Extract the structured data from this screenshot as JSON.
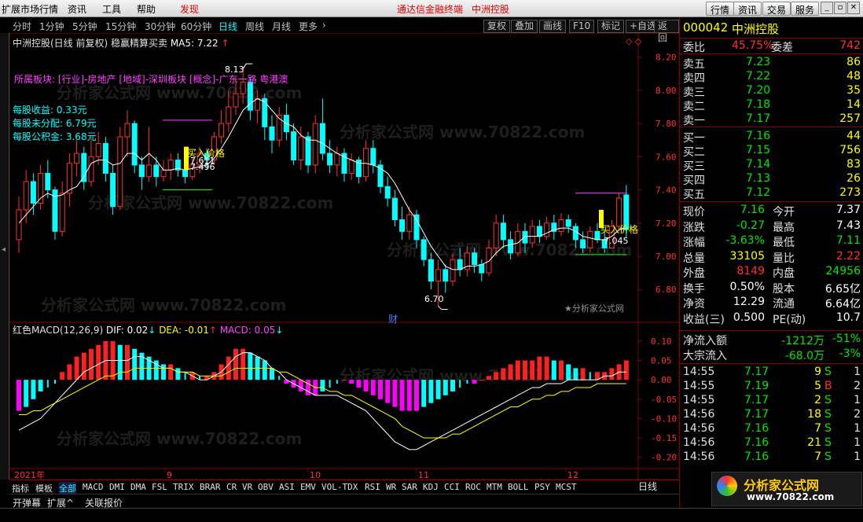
{
  "menu": {
    "items": [
      "扩展市场行情",
      "资讯",
      "工具",
      "帮助"
    ],
    "found": "发现",
    "center1": "通达信金融终端",
    "center2": "中洲控股",
    "right_buttons": [
      "行情",
      "资讯",
      "交易",
      "服务"
    ]
  },
  "periods": {
    "items": [
      "分时",
      "1分钟",
      "5分钟",
      "15分钟",
      "30分钟",
      "60分钟",
      "日线",
      "周线",
      "月线",
      "更多"
    ],
    "active": "日线"
  },
  "tools": [
    "复权",
    "叠加",
    "画线",
    "F10",
    "标记",
    "+自选",
    "返回"
  ],
  "main": {
    "title": "中洲控股(日线 前复权) 稳赢精算买卖",
    "ma": "MA5: 7.22",
    "sector": "所属板块: [行业]-房地产 [地域]-深圳板块 [概念]-广东一路 粤港澳",
    "eps": "每股收益: 0.33元",
    "undist": "每股未分配: 6.79元",
    "fund": "每股公积金: 3.68元",
    "high_label": "8.13",
    "low_label": "6.70",
    "buy_label1": "买入价格",
    "buy_val1a": "7.611",
    "buy_val1b": "7.496",
    "buy_label2": "买入价格",
    "buy_val2": "7.045",
    "cai": "财",
    "brand": "★分析家公式网"
  },
  "macd": {
    "title": "红色MACD(12,26,9)",
    "dif": "DIF: 0.02",
    "dea": "DEA: -0.01",
    "macd": "MACD: 0.05"
  },
  "axis": {
    "price_ticks": [
      "8.20",
      "8.00",
      "7.80",
      "7.60",
      "7.40",
      "7.20",
      "7.00",
      "6.80"
    ],
    "macd_ticks": [
      "0.10",
      "0.05",
      "0.00",
      "-0.05",
      "-0.10",
      "-0.15",
      "-0.20"
    ],
    "x_ticks": [
      "2021年",
      "9",
      "10",
      "11",
      "12"
    ]
  },
  "indicators": {
    "items": [
      "指标",
      "模板",
      "全部",
      "MACD",
      "DMI",
      "DMA",
      "FSL",
      "TRIX",
      "BRAR",
      "CR",
      "VR",
      "OBV",
      "ASI",
      "EMV",
      "VOL-TDX",
      "RSI",
      "WR",
      "SAR",
      "KDJ",
      "CCI",
      "ROC",
      "MTM",
      "BOLL",
      "PSY",
      "MCST"
    ],
    "active": "全部",
    "period": "日线"
  },
  "bottom2": {
    "items": [
      "开弹幕",
      "扩展^",
      "关联报价"
    ]
  },
  "stock": {
    "code": "000042",
    "name": "中洲控股"
  },
  "weibi": {
    "label1": "委比",
    "val1": "45.75%",
    "label2": "委差",
    "val2": "742"
  },
  "sell": [
    {
      "l": "卖五",
      "p": "7.23",
      "v": "86"
    },
    {
      "l": "卖四",
      "p": "7.22",
      "v": "48"
    },
    {
      "l": "卖三",
      "p": "7.20",
      "v": "35"
    },
    {
      "l": "卖二",
      "p": "7.18",
      "v": "14"
    },
    {
      "l": "卖一",
      "p": "7.17",
      "v": "257"
    }
  ],
  "buy": [
    {
      "l": "买一",
      "p": "7.16",
      "v": "44"
    },
    {
      "l": "买二",
      "p": "7.15",
      "v": "756"
    },
    {
      "l": "买三",
      "p": "7.14",
      "v": "83"
    },
    {
      "l": "买四",
      "p": "7.13",
      "v": "26"
    },
    {
      "l": "买五",
      "p": "7.12",
      "v": "273"
    }
  ],
  "quote": [
    {
      "l1": "现价",
      "v1": "7.16",
      "l2": "今开",
      "v2": "7.37"
    },
    {
      "l1": "涨跌",
      "v1": "-0.27",
      "l2": "最高",
      "v2": "7.43"
    },
    {
      "l1": "涨幅",
      "v1": "-3.63%",
      "l2": "最低",
      "v2": "7.11"
    },
    {
      "l1": "总量",
      "v1": "33105",
      "l2": "量比",
      "v2": "2.22"
    },
    {
      "l1": "外盘",
      "v1": "8149",
      "l2": "内盘",
      "v2": "24956"
    },
    {
      "l1": "换手",
      "v1": "0.50%",
      "l2": "股本",
      "v2": "6.65亿"
    },
    {
      "l1": "净资",
      "v1": "12.29",
      "l2": "流通",
      "v2": "6.64亿"
    },
    {
      "l1": "收益(三)",
      "v1": "0.500",
      "l2": "PE(动)",
      "v2": "10.7"
    }
  ],
  "flow": [
    {
      "l": "净流入额",
      "v": "-1212万",
      "p": "-51%"
    },
    {
      "l": "大宗流入",
      "v": "-68.0万",
      "p": "-3%"
    }
  ],
  "ticks": [
    {
      "t": "14:55",
      "p": "7.17",
      "v": "9",
      "d": "S",
      "n": "1"
    },
    {
      "t": "14:55",
      "p": "7.19",
      "v": "5",
      "d": "B",
      "n": "2"
    },
    {
      "t": "14:55",
      "p": "7.17",
      "v": "2",
      "d": "S",
      "n": "1"
    },
    {
      "t": "14:56",
      "p": "7.17",
      "v": "18",
      "d": "S",
      "n": "2"
    },
    {
      "t": "14:56",
      "p": "7.16",
      "v": "7",
      "d": "S",
      "n": "1"
    },
    {
      "t": "14:56",
      "p": "7.16",
      "v": "21",
      "d": "S",
      "n": "1"
    },
    {
      "t": "14:56",
      "p": "7.16",
      "v": "7",
      "d": "S",
      "n": "1"
    }
  ],
  "watermark": {
    "site": "分析家公式网",
    "url": "www.70822.com",
    "wm": "分析家公式网 www.70822.com"
  },
  "chart_data": {
    "type": "candlestick",
    "ylim": [
      6.64,
      8.26
    ],
    "candles": [
      [
        7.1,
        7.28,
        7.36,
        7.02
      ],
      [
        7.28,
        7.45,
        7.52,
        7.2
      ],
      [
        7.45,
        7.32,
        7.5,
        7.25
      ],
      [
        7.32,
        7.5,
        7.55,
        7.28
      ],
      [
        7.5,
        7.4,
        7.58,
        7.35
      ],
      [
        7.4,
        7.15,
        7.42,
        7.1
      ],
      [
        7.15,
        7.38,
        7.45,
        7.12
      ],
      [
        7.38,
        7.56,
        7.62,
        7.3
      ],
      [
        7.56,
        7.62,
        7.7,
        7.48
      ],
      [
        7.62,
        7.45,
        7.66,
        7.4
      ],
      [
        7.45,
        7.6,
        7.72,
        7.42
      ],
      [
        7.6,
        7.68,
        7.75,
        7.55
      ],
      [
        7.68,
        7.5,
        7.72,
        7.45
      ],
      [
        7.5,
        7.3,
        7.55,
        7.25
      ],
      [
        7.3,
        7.72,
        7.78,
        7.28
      ],
      [
        7.72,
        7.8,
        7.88,
        7.6
      ],
      [
        7.8,
        7.55,
        7.82,
        7.5
      ],
      [
        7.55,
        7.48,
        7.6,
        7.4
      ],
      [
        7.48,
        7.55,
        7.78,
        7.45
      ],
      [
        7.55,
        7.48,
        7.6,
        7.42
      ],
      [
        7.48,
        7.52,
        7.58,
        7.45
      ],
      [
        7.52,
        7.58,
        7.62,
        7.46
      ],
      [
        7.58,
        7.52,
        7.62,
        7.48
      ],
      [
        7.52,
        7.48,
        7.6,
        7.44
      ],
      [
        7.48,
        7.55,
        7.6,
        7.46
      ],
      [
        7.55,
        7.62,
        7.66,
        7.5
      ],
      [
        7.62,
        7.58,
        7.65,
        7.52
      ],
      [
        7.58,
        7.72,
        7.75,
        7.55
      ],
      [
        7.72,
        7.8,
        7.88,
        7.68
      ],
      [
        7.8,
        7.9,
        8.0,
        7.75
      ],
      [
        7.9,
        7.98,
        8.08,
        7.85
      ],
      [
        7.98,
        8.05,
        8.13,
        7.92
      ],
      [
        8.05,
        7.88,
        8.08,
        7.82
      ],
      [
        7.88,
        7.95,
        8.0,
        7.8
      ],
      [
        7.95,
        7.78,
        7.98,
        7.7
      ],
      [
        7.78,
        7.7,
        7.85,
        7.62
      ],
      [
        7.7,
        7.85,
        7.9,
        7.66
      ],
      [
        7.85,
        7.75,
        7.92,
        7.7
      ],
      [
        7.75,
        7.58,
        7.8,
        7.55
      ],
      [
        7.58,
        7.72,
        7.78,
        7.52
      ],
      [
        7.72,
        7.55,
        7.75,
        7.5
      ],
      [
        7.55,
        7.8,
        7.85,
        7.5
      ],
      [
        7.8,
        7.62,
        7.95,
        7.58
      ],
      [
        7.62,
        7.55,
        7.7,
        7.5
      ],
      [
        7.55,
        7.62,
        7.66,
        7.48
      ],
      [
        7.62,
        7.5,
        7.65,
        7.45
      ],
      [
        7.5,
        7.58,
        7.62,
        7.46
      ],
      [
        7.58,
        7.48,
        7.6,
        7.44
      ],
      [
        7.48,
        7.65,
        7.7,
        7.45
      ],
      [
        7.65,
        7.55,
        7.7,
        7.5
      ],
      [
        7.55,
        7.42,
        7.58,
        7.38
      ],
      [
        7.42,
        7.35,
        7.48,
        7.3
      ],
      [
        7.35,
        7.22,
        7.4,
        7.18
      ],
      [
        7.22,
        7.15,
        7.3,
        7.1
      ],
      [
        7.15,
        7.25,
        7.3,
        7.1
      ],
      [
        7.25,
        7.1,
        7.28,
        7.05
      ],
      [
        7.1,
        6.98,
        7.12,
        6.94
      ],
      [
        6.98,
        6.85,
        7.02,
        6.8
      ],
      [
        6.85,
        6.92,
        6.98,
        6.7
      ],
      [
        6.92,
        6.85,
        6.95,
        6.78
      ],
      [
        6.85,
        6.98,
        7.02,
        6.82
      ],
      [
        6.98,
        6.92,
        7.05,
        6.88
      ],
      [
        6.92,
        7.02,
        7.06,
        6.88
      ],
      [
        7.02,
        6.95,
        7.05,
        6.9
      ],
      [
        6.95,
        6.9,
        6.98,
        6.85
      ],
      [
        6.9,
        7.05,
        7.1,
        6.88
      ],
      [
        7.05,
        7.2,
        7.25,
        7.0
      ],
      [
        7.2,
        7.1,
        7.25,
        7.05
      ],
      [
        7.1,
        7.02,
        7.15,
        6.98
      ],
      [
        7.02,
        7.15,
        7.2,
        7.0
      ],
      [
        7.15,
        7.08,
        7.2,
        7.02
      ],
      [
        7.08,
        7.18,
        7.22,
        7.05
      ],
      [
        7.18,
        7.12,
        7.22,
        7.08
      ],
      [
        7.12,
        7.2,
        7.24,
        7.1
      ],
      [
        7.2,
        7.15,
        7.25,
        7.1
      ],
      [
        7.15,
        7.22,
        7.26,
        7.12
      ],
      [
        7.22,
        7.18,
        7.25,
        7.14
      ],
      [
        7.18,
        7.1,
        7.2,
        7.05
      ],
      [
        7.1,
        7.05,
        7.15,
        7.02
      ],
      [
        7.05,
        7.15,
        7.18,
        7.02
      ],
      [
        7.15,
        7.1,
        7.2,
        7.08
      ],
      [
        7.1,
        7.05,
        7.15,
        7.02
      ],
      [
        7.05,
        7.18,
        7.22,
        7.05
      ],
      [
        7.18,
        7.35,
        7.38,
        7.15
      ],
      [
        7.37,
        7.16,
        7.43,
        7.11
      ]
    ],
    "ma5": [
      7.2,
      7.25,
      7.3,
      7.35,
      7.38,
      7.36,
      7.37,
      7.4,
      7.42,
      7.48,
      7.56,
      7.58,
      7.58,
      7.55,
      7.56,
      7.62,
      7.62,
      7.58,
      7.62,
      7.58,
      7.52,
      7.52,
      7.53,
      7.52,
      7.53,
      7.54,
      7.55,
      7.59,
      7.65,
      7.72,
      7.8,
      7.88,
      7.92,
      7.95,
      7.93,
      7.88,
      7.83,
      7.8,
      7.78,
      7.73,
      7.7,
      7.7,
      7.68,
      7.65,
      7.62,
      7.6,
      7.58,
      7.56,
      7.56,
      7.55,
      7.53,
      7.5,
      7.44,
      7.36,
      7.28,
      7.22,
      7.14,
      7.06,
      7.0,
      6.94,
      6.92,
      6.92,
      6.94,
      6.94,
      6.95,
      6.97,
      7.02,
      7.06,
      7.07,
      7.08,
      7.12,
      7.12,
      7.12,
      7.14,
      7.16,
      7.17,
      7.17,
      7.15,
      7.12,
      7.11,
      7.1,
      7.1,
      7.12,
      7.16,
      7.17
    ],
    "macd_hist": [
      -0.08,
      -0.07,
      -0.05,
      -0.03,
      -0.02,
      -0.01,
      0.02,
      0.04,
      0.06,
      0.07,
      0.08,
      0.09,
      0.1,
      0.1,
      0.09,
      0.09,
      0.08,
      0.07,
      0.06,
      0.05,
      0.04,
      0.04,
      0.03,
      0.02,
      0.02,
      0.01,
      0.01,
      0.02,
      0.04,
      0.06,
      0.08,
      0.08,
      0.07,
      0.06,
      0.05,
      0.03,
      0.01,
      -0.01,
      -0.02,
      -0.03,
      -0.04,
      -0.04,
      -0.03,
      -0.02,
      -0.01,
      0.0,
      -0.01,
      -0.02,
      -0.03,
      -0.04,
      -0.05,
      -0.06,
      -0.07,
      -0.08,
      -0.08,
      -0.08,
      -0.07,
      -0.06,
      -0.05,
      -0.04,
      -0.03,
      -0.02,
      -0.01,
      -0.01,
      0.0,
      0.01,
      0.02,
      0.03,
      0.04,
      0.05,
      0.05,
      0.05,
      0.06,
      0.06,
      0.05,
      0.05,
      0.04,
      0.03,
      0.03,
      0.02,
      0.02,
      0.02,
      0.03,
      0.04,
      0.05
    ],
    "dif": [
      -0.13,
      -0.12,
      -0.11,
      -0.1,
      -0.08,
      -0.06,
      -0.04,
      -0.02,
      0.0,
      0.02,
      0.03,
      0.04,
      0.05,
      0.05,
      0.05,
      0.05,
      0.06,
      0.06,
      0.05,
      0.04,
      0.03,
      0.03,
      0.02,
      0.02,
      0.01,
      0.0,
      0.0,
      0.01,
      0.02,
      0.04,
      0.06,
      0.07,
      0.07,
      0.06,
      0.05,
      0.03,
      0.02,
      0.0,
      -0.01,
      -0.02,
      -0.03,
      -0.04,
      -0.04,
      -0.04,
      -0.04,
      -0.05,
      -0.06,
      -0.07,
      -0.08,
      -0.1,
      -0.12,
      -0.14,
      -0.16,
      -0.17,
      -0.18,
      -0.18,
      -0.17,
      -0.16,
      -0.15,
      -0.14,
      -0.13,
      -0.12,
      -0.11,
      -0.1,
      -0.09,
      -0.08,
      -0.07,
      -0.06,
      -0.05,
      -0.04,
      -0.03,
      -0.02,
      -0.02,
      -0.01,
      -0.01,
      -0.01,
      0.0,
      0.0,
      0.0,
      0.0,
      0.0,
      0.01,
      0.01,
      0.02,
      0.02
    ],
    "dea": [
      -0.09,
      -0.09,
      -0.08,
      -0.08,
      -0.07,
      -0.06,
      -0.05,
      -0.04,
      -0.03,
      -0.02,
      -0.01,
      0.0,
      0.01,
      0.01,
      0.02,
      0.02,
      0.03,
      0.03,
      0.03,
      0.03,
      0.03,
      0.03,
      0.02,
      0.02,
      0.02,
      0.01,
      0.01,
      0.01,
      0.01,
      0.02,
      0.03,
      0.03,
      0.03,
      0.03,
      0.03,
      0.03,
      0.02,
      0.02,
      0.01,
      0.0,
      -0.01,
      -0.02,
      -0.02,
      -0.03,
      -0.03,
      -0.04,
      -0.04,
      -0.05,
      -0.06,
      -0.07,
      -0.08,
      -0.09,
      -0.1,
      -0.12,
      -0.13,
      -0.14,
      -0.15,
      -0.15,
      -0.15,
      -0.15,
      -0.14,
      -0.14,
      -0.13,
      -0.12,
      -0.11,
      -0.1,
      -0.09,
      -0.08,
      -0.07,
      -0.07,
      -0.06,
      -0.05,
      -0.05,
      -0.04,
      -0.04,
      -0.03,
      -0.03,
      -0.02,
      -0.02,
      -0.02,
      -0.01,
      -0.01,
      -0.01,
      -0.01,
      -0.01
    ]
  },
  "colors": {
    "up": "#ff3030",
    "down": "#00ffff",
    "ma": "#ffffff",
    "dif": "#ffffff",
    "dea": "#ffff00",
    "hist_up": "#ff2020",
    "hist_down": "#ff00ff",
    "grid": "#800000"
  }
}
